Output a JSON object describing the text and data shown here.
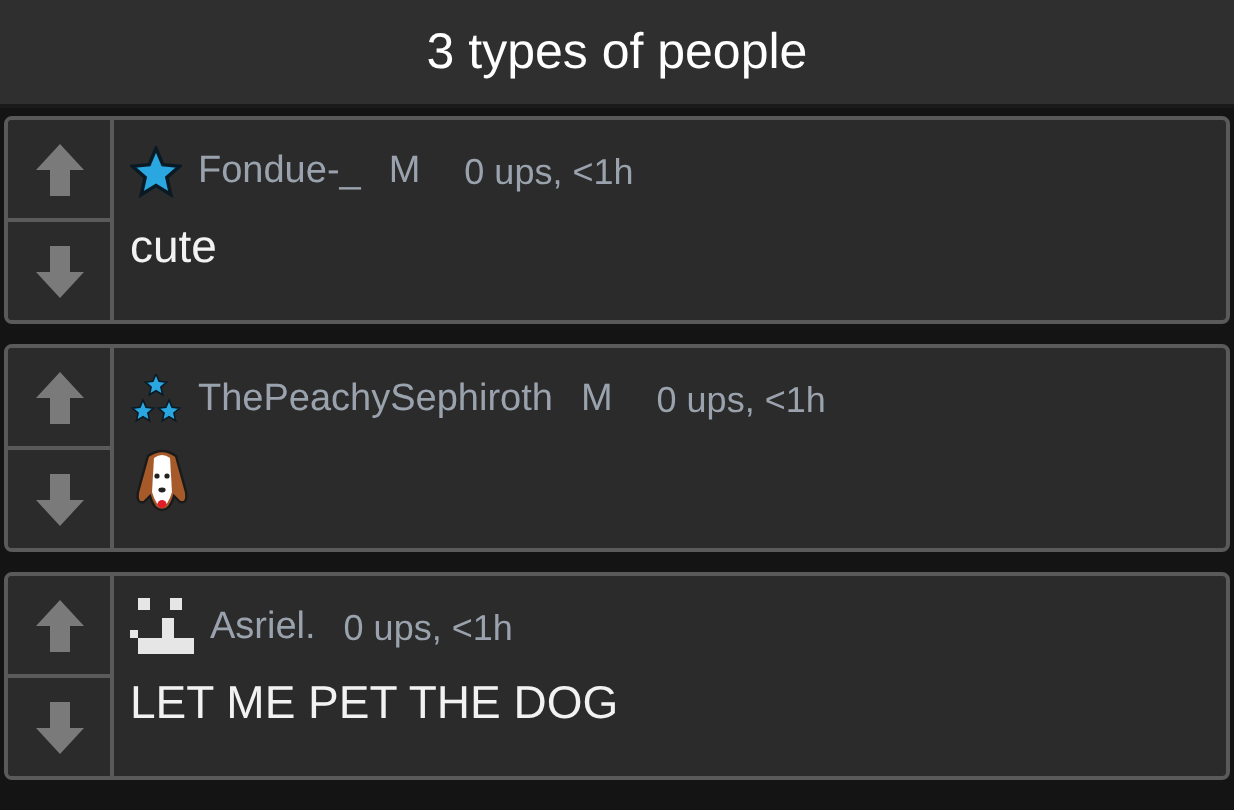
{
  "title": "3 types of people",
  "comments": [
    {
      "kind": "text",
      "author": "Fondue-_",
      "badge": "M",
      "meta": "0 ups, <1h",
      "body": "cute"
    },
    {
      "kind": "icon",
      "author": "ThePeachySephiroth",
      "badge": "M",
      "meta": "0 ups, <1h"
    },
    {
      "kind": "text",
      "author": "Asriel.",
      "meta": "0 ups, <1h",
      "body": "LET ME PET THE DOG"
    }
  ]
}
